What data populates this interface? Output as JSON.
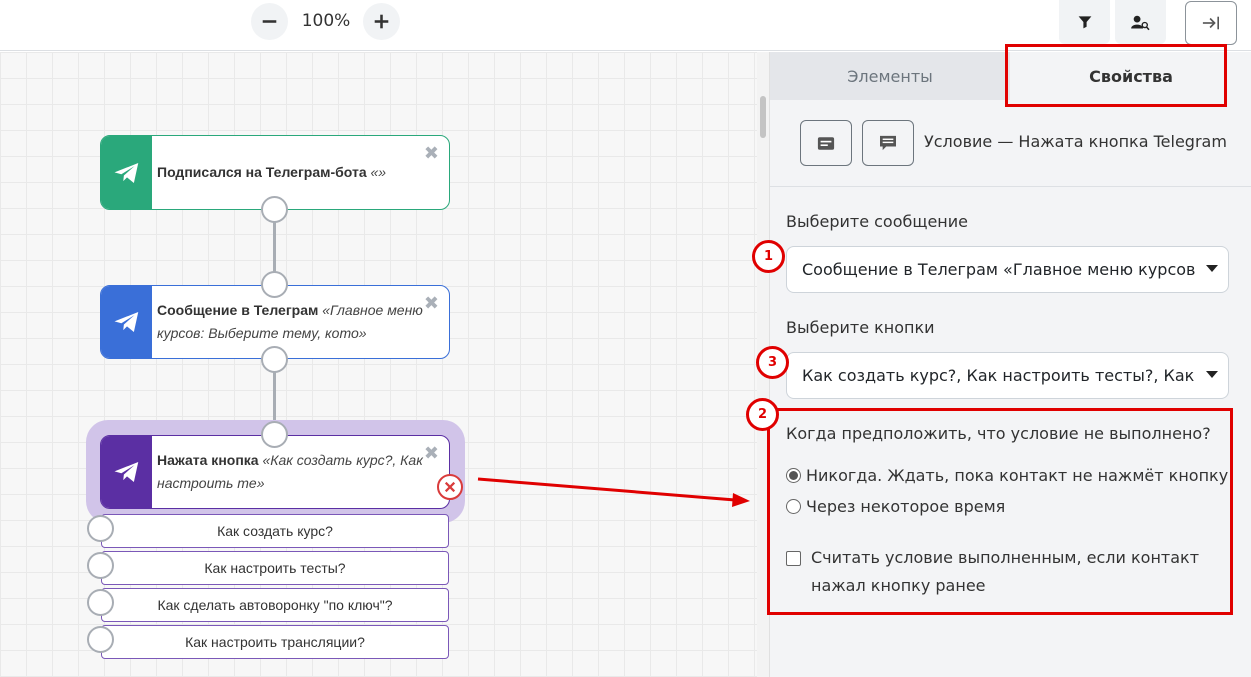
{
  "toolbar": {
    "zoom_level": "100%",
    "zoom_out_icon": "minus-icon",
    "zoom_in_icon": "plus-icon",
    "filter_icon": "filter-icon",
    "search_contact_icon": "user-search-icon",
    "collapse_icon": "collapse-right-icon"
  },
  "canvas": {
    "nodes": [
      {
        "id": "subscribe",
        "title": "Подписался на Телеграм-бота",
        "detail": "«»",
        "color": "#2aa87b",
        "icon": "telegram-icon"
      },
      {
        "id": "message",
        "title": "Сообщение в Телеграм",
        "detail": "«Главное меню курсов: Выберите тему, кото»",
        "color": "#3a6fd8",
        "icon": "telegram-icon"
      },
      {
        "id": "button-pressed",
        "title": "Нажата кнопка",
        "detail": "«Как создать курс?, Как настроить те»",
        "color": "#5b2fa3",
        "icon": "telegram-icon"
      }
    ],
    "buttons": [
      "Как создать курс?",
      "Как настроить тесты?",
      "Как сделать автоворонку \"по ключ\"?",
      "Как настроить трансляции?"
    ],
    "close_glyph": "✖"
  },
  "panel": {
    "tabs": [
      {
        "label": "Элементы",
        "active": false
      },
      {
        "label": "Свойства",
        "active": true
      }
    ],
    "condition_title": "Условие — Нажата кнопка Telegram",
    "select_message_label": "Выберите сообщение",
    "select_message_value": "Сообщение в Телеграм «Главное меню курсов",
    "select_buttons_label": "Выберите кнопки",
    "select_buttons_value": "Как создать курс?, Как настроить тесты?, Как",
    "when_failed_label": "Когда предположить, что условие не выполнено?",
    "radio_options": [
      {
        "label": "Никогда. Ждать, пока контакт не нажмёт кнопку",
        "checked": true
      },
      {
        "label": "Через некоторое время",
        "checked": false
      }
    ],
    "checkbox_label": "Считать условие выполненным, если контакт нажал кнопку ранее",
    "checkbox_checked": false
  },
  "annotations": {
    "badges": [
      "1",
      "2",
      "3"
    ],
    "color": "#e00000"
  }
}
